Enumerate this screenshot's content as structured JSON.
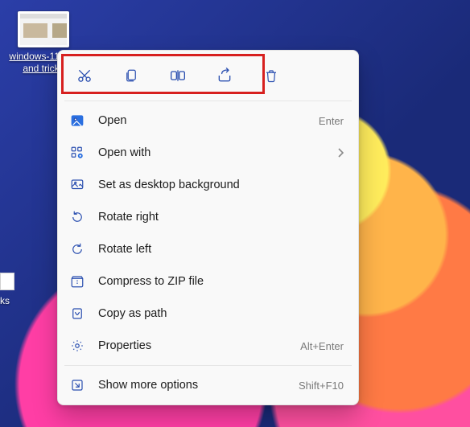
{
  "desktop": {
    "icon_label": "windows-11-tips and tricks"
  },
  "relabel": {
    "text": "ks"
  },
  "context_menu": {
    "quick_actions": [
      {
        "name": "cut"
      },
      {
        "name": "copy"
      },
      {
        "name": "rename"
      },
      {
        "name": "share"
      },
      {
        "name": "delete"
      }
    ],
    "items": [
      {
        "icon": "image",
        "label": "Open",
        "shortcut": "Enter",
        "submenu": false
      },
      {
        "icon": "openwith",
        "label": "Open with",
        "shortcut": "",
        "submenu": true
      },
      {
        "icon": "wallpaper",
        "label": "Set as desktop background",
        "shortcut": "",
        "submenu": false
      },
      {
        "icon": "rotate-right",
        "label": "Rotate right",
        "shortcut": "",
        "submenu": false
      },
      {
        "icon": "rotate-left",
        "label": "Rotate left",
        "shortcut": "",
        "submenu": false
      },
      {
        "icon": "zip",
        "label": "Compress to ZIP file",
        "shortcut": "",
        "submenu": false
      },
      {
        "icon": "copypath",
        "label": "Copy as path",
        "shortcut": "",
        "submenu": false
      },
      {
        "icon": "properties",
        "label": "Properties",
        "shortcut": "Alt+Enter",
        "submenu": false
      }
    ],
    "more": {
      "label": "Show more options",
      "shortcut": "Shift+F10"
    }
  }
}
